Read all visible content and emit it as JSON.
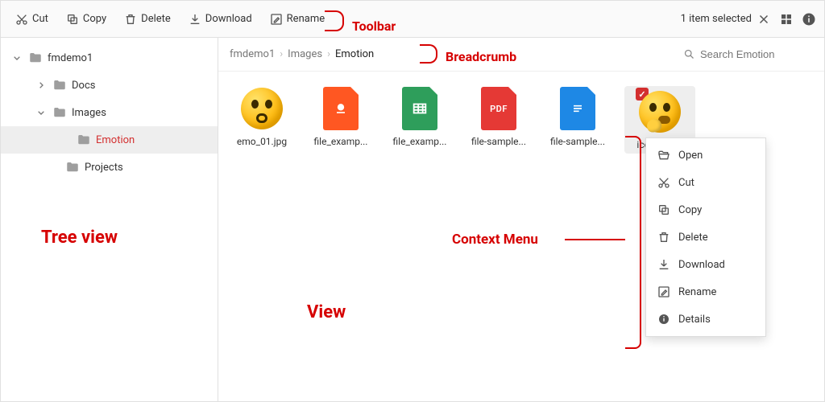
{
  "toolbar": {
    "cut": "Cut",
    "copy": "Copy",
    "delete": "Delete",
    "download": "Download",
    "rename": "Rename",
    "selection_text": "1 item selected"
  },
  "tree": {
    "root": "fmdemo1",
    "docs": "Docs",
    "images": "Images",
    "emotion": "Emotion",
    "projects": "Projects"
  },
  "breadcrumb": {
    "items": [
      "fmdemo1",
      "Images",
      "Emotion"
    ]
  },
  "search": {
    "placeholder": "Search Emotion"
  },
  "files": [
    {
      "name": "emo_01.jpg",
      "kind": "emoji-shock"
    },
    {
      "name": "file_examp...",
      "kind": "ppt"
    },
    {
      "name": "file_examp...",
      "kind": "xls"
    },
    {
      "name": "file-sample...",
      "kind": "pdf"
    },
    {
      "name": "file-sample...",
      "kind": "doc"
    },
    {
      "name": "ico_thinkin",
      "kind": "emoji-think",
      "selected": true
    }
  ],
  "context_menu": {
    "open": "Open",
    "cut": "Cut",
    "copy": "Copy",
    "delete": "Delete",
    "download": "Download",
    "rename": "Rename",
    "details": "Details"
  },
  "annotations": {
    "toolbar": "Toolbar",
    "breadcrumb": "Breadcrumb",
    "tree": "Tree view",
    "context": "Context Menu",
    "view": "View"
  }
}
